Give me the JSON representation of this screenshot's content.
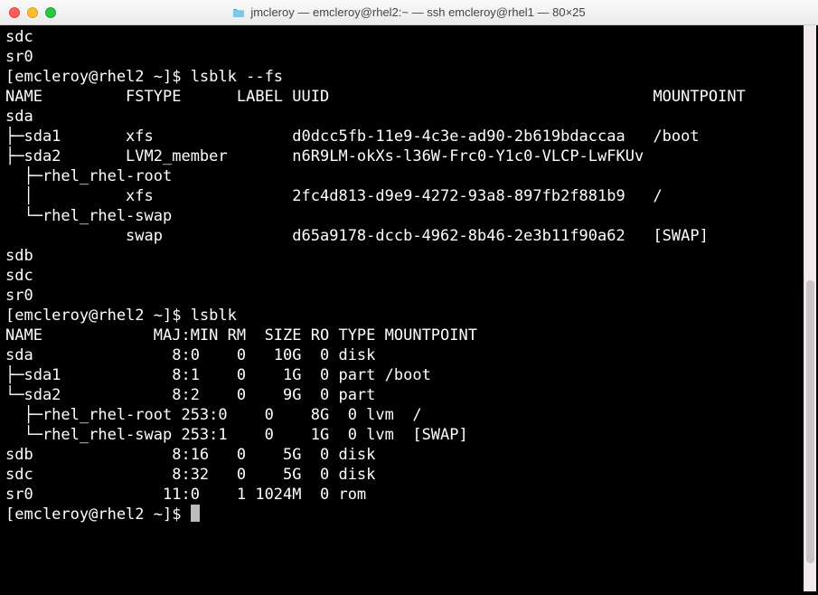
{
  "window": {
    "title": "jmcleroy — emcleroy@rhel2:~ — ssh emcleroy@rhel1 — 80×25"
  },
  "terminal": {
    "lines": [
      "sdc",
      "sr0",
      "[emcleroy@rhel2 ~]$ lsblk --fs",
      "NAME         FSTYPE      LABEL UUID                                   MOUNTPOINT",
      "sda",
      "├─sda1       xfs               d0dcc5fb-11e9-4c3e-ad90-2b619bdaccaa   /boot",
      "├─sda2       LVM2_member       n6R9LM-okXs-l36W-Frc0-Y1c0-VLCP-LwFKUv",
      "  ├─rhel_rhel-root",
      "  │          xfs               2fc4d813-d9e9-4272-93a8-897fb2f881b9   /",
      "  └─rhel_rhel-swap",
      "             swap              d65a9178-dccb-4962-8b46-2e3b11f90a62   [SWAP]",
      "sdb",
      "sdc",
      "sr0",
      "[emcleroy@rhel2 ~]$ lsblk",
      "NAME            MAJ:MIN RM  SIZE RO TYPE MOUNTPOINT",
      "sda               8:0    0   10G  0 disk",
      "├─sda1            8:1    0    1G  0 part /boot",
      "└─sda2            8:2    0    9G  0 part",
      "  ├─rhel_rhel-root 253:0    0    8G  0 lvm  /",
      "  └─rhel_rhel-swap 253:1    0    1G  0 lvm  [SWAP]",
      "sdb               8:16   0    5G  0 disk",
      "sdc               8:32   0    5G  0 disk",
      "sr0              11:0    1 1024M  0 rom",
      "[emcleroy@rhel2 ~]$ "
    ]
  },
  "commands": {
    "prompt": "[emcleroy@rhel2 ~]$",
    "cmd1": "lsblk --fs",
    "cmd2": "lsblk"
  },
  "lsblk_fs": {
    "headers": [
      "NAME",
      "FSTYPE",
      "LABEL",
      "UUID",
      "MOUNTPOINT"
    ],
    "rows": [
      {
        "name": "sda"
      },
      {
        "name": "sda1",
        "fstype": "xfs",
        "uuid": "d0dcc5fb-11e9-4c3e-ad90-2b619bdaccaa",
        "mountpoint": "/boot"
      },
      {
        "name": "sda2",
        "fstype": "LVM2_member",
        "uuid": "n6R9LM-okXs-l36W-Frc0-Y1c0-VLCP-LwFKUv"
      },
      {
        "name": "rhel_rhel-root",
        "fstype": "xfs",
        "uuid": "2fc4d813-d9e9-4272-93a8-897fb2f881b9",
        "mountpoint": "/"
      },
      {
        "name": "rhel_rhel-swap",
        "fstype": "swap",
        "uuid": "d65a9178-dccb-4962-8b46-2e3b11f90a62",
        "mountpoint": "[SWAP]"
      },
      {
        "name": "sdb"
      },
      {
        "name": "sdc"
      },
      {
        "name": "sr0"
      }
    ]
  },
  "lsblk_plain": {
    "headers": [
      "NAME",
      "MAJ:MIN",
      "RM",
      "SIZE",
      "RO",
      "TYPE",
      "MOUNTPOINT"
    ],
    "rows": [
      {
        "name": "sda",
        "majmin": "8:0",
        "rm": "0",
        "size": "10G",
        "ro": "0",
        "type": "disk"
      },
      {
        "name": "sda1",
        "majmin": "8:1",
        "rm": "0",
        "size": "1G",
        "ro": "0",
        "type": "part",
        "mountpoint": "/boot"
      },
      {
        "name": "sda2",
        "majmin": "8:2",
        "rm": "0",
        "size": "9G",
        "ro": "0",
        "type": "part"
      },
      {
        "name": "rhel_rhel-root",
        "majmin": "253:0",
        "rm": "0",
        "size": "8G",
        "ro": "0",
        "type": "lvm",
        "mountpoint": "/"
      },
      {
        "name": "rhel_rhel-swap",
        "majmin": "253:1",
        "rm": "0",
        "size": "1G",
        "ro": "0",
        "type": "lvm",
        "mountpoint": "[SWAP]"
      },
      {
        "name": "sdb",
        "majmin": "8:16",
        "rm": "0",
        "size": "5G",
        "ro": "0",
        "type": "disk"
      },
      {
        "name": "sdc",
        "majmin": "8:32",
        "rm": "0",
        "size": "5G",
        "ro": "0",
        "type": "disk"
      },
      {
        "name": "sr0",
        "majmin": "11:0",
        "rm": "1",
        "size": "1024M",
        "ro": "0",
        "type": "rom"
      }
    ]
  }
}
